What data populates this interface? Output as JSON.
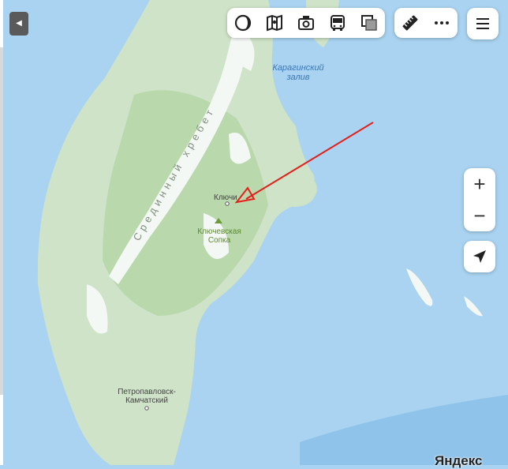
{
  "map": {
    "colors": {
      "sea": "#a9d3f0",
      "land": "#cfe3c8",
      "forest": "#b7d6a9",
      "snow": "#ffffff",
      "arrow": "#e3201b"
    },
    "labels": {
      "karaginsky_gulf": [
        "Карагинский",
        "залив"
      ],
      "ridge": "Срединный хребет",
      "klyuchi": "Ключи",
      "klyuchevskaya": [
        "Ключевская",
        "Сопка"
      ],
      "petropavlovsk": [
        "Петропавловск-",
        "Камчатский"
      ]
    },
    "brand": "Яндекс"
  },
  "toolbar": {
    "layers_icon": "layers-circle-icon",
    "map_mode_icon": "map-mode-icon",
    "panorama_icon": "camera-icon",
    "transit_icon": "bus-icon",
    "overlay_icon": "overlay-squares-icon",
    "ruler_icon": "ruler-icon",
    "more_icon": "more-dots-icon",
    "menu_icon": "hamburger-icon"
  },
  "controls": {
    "zoom_in": "+",
    "zoom_out": "−",
    "locate_icon": "location-arrow-icon",
    "collapse_icon": "◀"
  }
}
